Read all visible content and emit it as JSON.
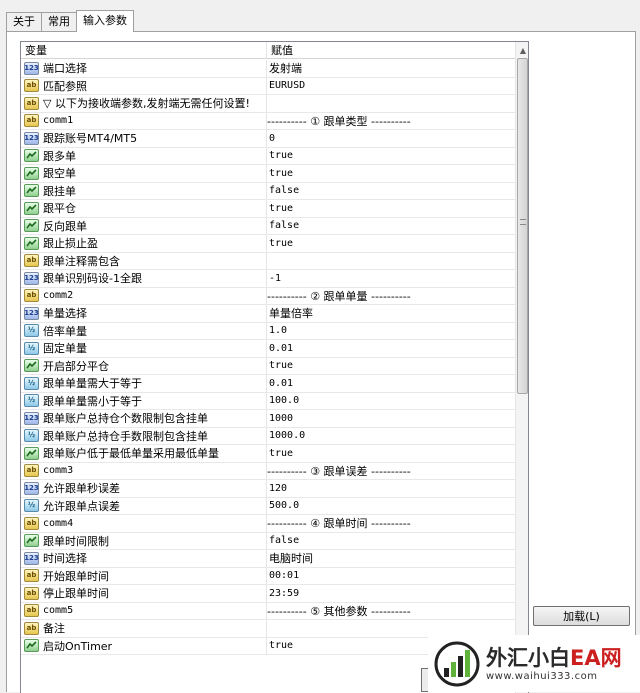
{
  "tabs": [
    "关于",
    "常用",
    "输入参数"
  ],
  "columns": {
    "variable": "变量",
    "value": "赋值"
  },
  "rows": [
    {
      "icon": "num",
      "name": "端口选择",
      "value": "发射端"
    },
    {
      "icon": "str",
      "name": "匹配参照",
      "value": "EURUSD"
    },
    {
      "icon": "str",
      "name": "▽ 以下为接收端参数,发射端无需任何设置!",
      "value": ""
    },
    {
      "icon": "str",
      "name": "comm1",
      "value": "---------- ① 跟单类型 ----------"
    },
    {
      "icon": "num",
      "name": "跟踪账号MT4/MT5",
      "value": "0"
    },
    {
      "icon": "bool",
      "name": "跟多单",
      "value": "true"
    },
    {
      "icon": "bool",
      "name": "跟空单",
      "value": "true"
    },
    {
      "icon": "bool",
      "name": "跟挂单",
      "value": "false"
    },
    {
      "icon": "bool",
      "name": "跟平仓",
      "value": "true"
    },
    {
      "icon": "bool",
      "name": "反向跟单",
      "value": "false"
    },
    {
      "icon": "bool",
      "name": "跟止损止盈",
      "value": "true"
    },
    {
      "icon": "str",
      "name": "跟单注释需包含",
      "value": ""
    },
    {
      "icon": "num",
      "name": "跟单识别码设-1全跟",
      "value": "-1"
    },
    {
      "icon": "str",
      "name": "comm2",
      "value": "---------- ② 跟单单量 ----------"
    },
    {
      "icon": "num",
      "name": "单量选择",
      "value": "单量倍率"
    },
    {
      "icon": "dbl",
      "name": "倍率单量",
      "value": "1.0"
    },
    {
      "icon": "dbl",
      "name": "固定单量",
      "value": "0.01"
    },
    {
      "icon": "bool",
      "name": "开启部分平仓",
      "value": "true"
    },
    {
      "icon": "dbl",
      "name": "跟单单量需大于等于",
      "value": "0.01"
    },
    {
      "icon": "dbl",
      "name": "跟单单量需小于等于",
      "value": "100.0"
    },
    {
      "icon": "num",
      "name": "跟单账户总持仓个数限制包含挂单",
      "value": "1000"
    },
    {
      "icon": "dbl",
      "name": "跟单账户总持仓手数限制包含挂单",
      "value": "1000.0"
    },
    {
      "icon": "bool",
      "name": "跟单账户低于最低单量采用最低单量",
      "value": "true"
    },
    {
      "icon": "str",
      "name": "comm3",
      "value": "---------- ③ 跟单误差 ----------"
    },
    {
      "icon": "num",
      "name": "允许跟单秒误差",
      "value": "120"
    },
    {
      "icon": "dbl",
      "name": "允许跟单点误差",
      "value": "500.0"
    },
    {
      "icon": "str",
      "name": "comm4",
      "value": "---------- ④ 跟单时间 ----------"
    },
    {
      "icon": "bool",
      "name": "跟单时间限制",
      "value": "false"
    },
    {
      "icon": "num",
      "name": "时间选择",
      "value": "电脑时间"
    },
    {
      "icon": "str",
      "name": "开始跟单时间",
      "value": "00:01"
    },
    {
      "icon": "str",
      "name": "停止跟单时间",
      "value": "23:59"
    },
    {
      "icon": "str",
      "name": "comm5",
      "value": "---------- ⑤ 其他参数 ----------"
    },
    {
      "icon": "str",
      "name": "备注",
      "value": ""
    },
    {
      "icon": "bool",
      "name": "启动OnTimer",
      "value": "true"
    }
  ],
  "buttons": {
    "load": "加载(L)"
  },
  "watermark": {
    "title_a": "外汇小白",
    "title_b": "EA网",
    "url": "www.waihui333.com"
  },
  "colors": {
    "ea_red": "#cc1f1f",
    "selection": "#3399ff"
  }
}
